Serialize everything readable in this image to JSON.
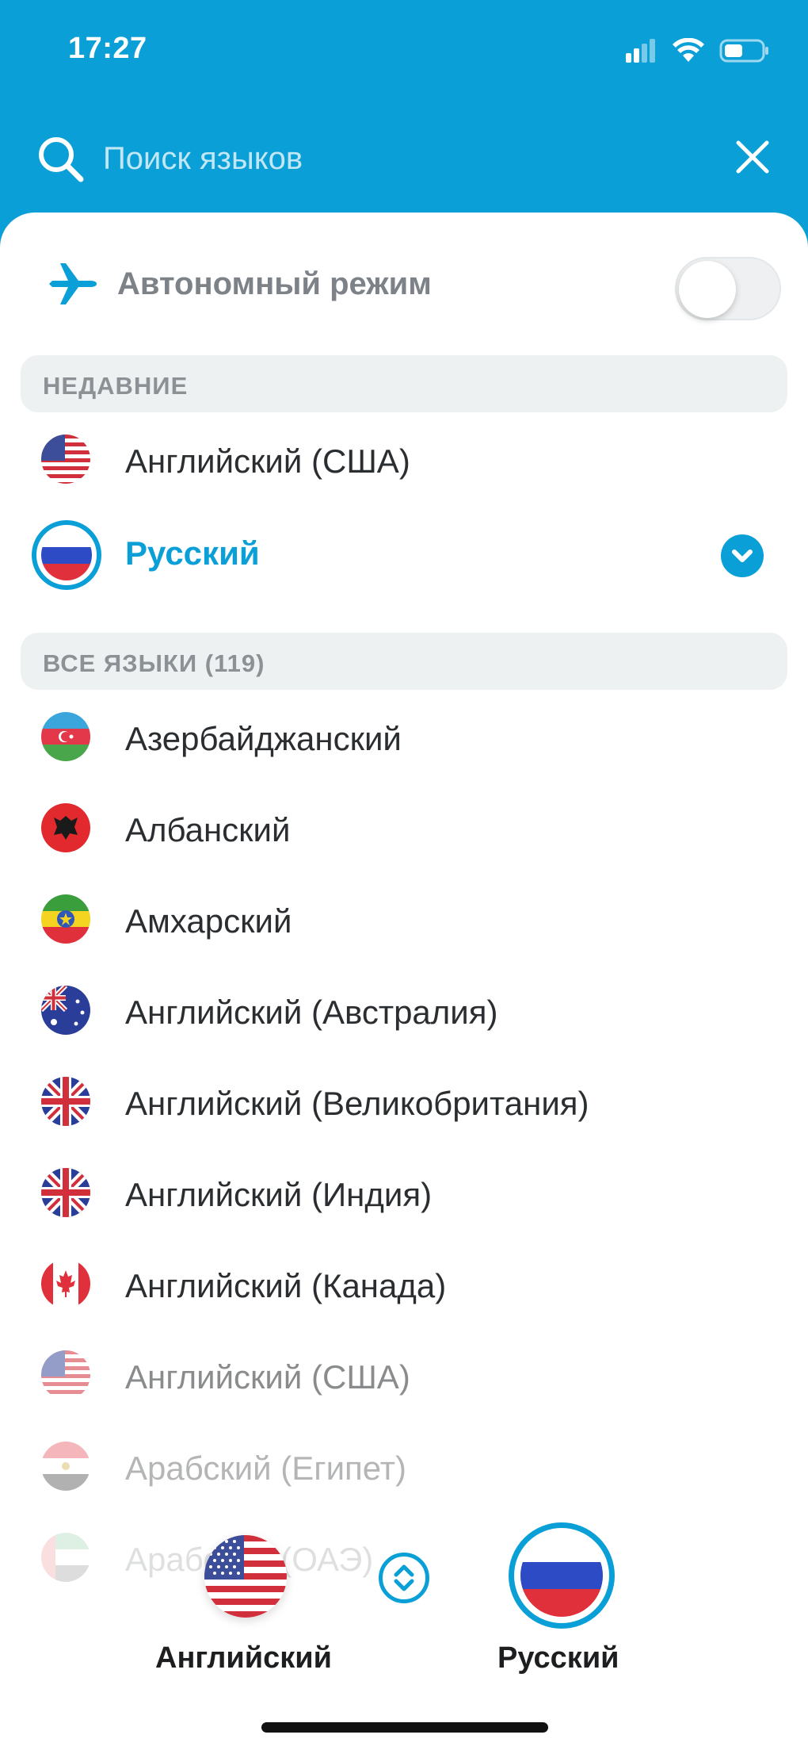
{
  "status_bar": {
    "time": "17:27"
  },
  "search": {
    "placeholder": "Поиск языков"
  },
  "offline": {
    "label": "Автономный режим",
    "enabled": false
  },
  "recent": {
    "header": "НЕДАВНИЕ",
    "items": [
      {
        "label": "Английский (США)",
        "flag": "us-flag-icon"
      },
      {
        "label": "Русский",
        "flag": "ru-flag-icon",
        "selected": true
      }
    ]
  },
  "all_languages": {
    "header": "ВСЕ ЯЗЫКИ (119)",
    "items": [
      {
        "label": "Азербайджанский",
        "flag": "az-flag-icon"
      },
      {
        "label": "Албанский",
        "flag": "al-flag-icon"
      },
      {
        "label": "Амхарский",
        "flag": "et-flag-icon"
      },
      {
        "label": "Английский (Австралия)",
        "flag": "au-flag-icon"
      },
      {
        "label": "Английский (Великобритания)",
        "flag": "gb-flag-icon"
      },
      {
        "label": "Английский (Индия)",
        "flag": "gb-flag-icon"
      },
      {
        "label": "Английский (Канада)",
        "flag": "ca-flag-icon"
      },
      {
        "label": "Английский (США)",
        "flag": "us-flag-icon"
      },
      {
        "label": "Арабский (Египет)",
        "flag": "eg-flag-icon"
      },
      {
        "label": "Арабский (ОАЭ)",
        "flag": "ae-flag-icon"
      }
    ]
  },
  "bottom_bar": {
    "source_label": "Английский",
    "target_label": "Русский"
  },
  "colors": {
    "accent": "#0a9fd6",
    "text": "#2b2e31",
    "muted": "#8c9196"
  }
}
